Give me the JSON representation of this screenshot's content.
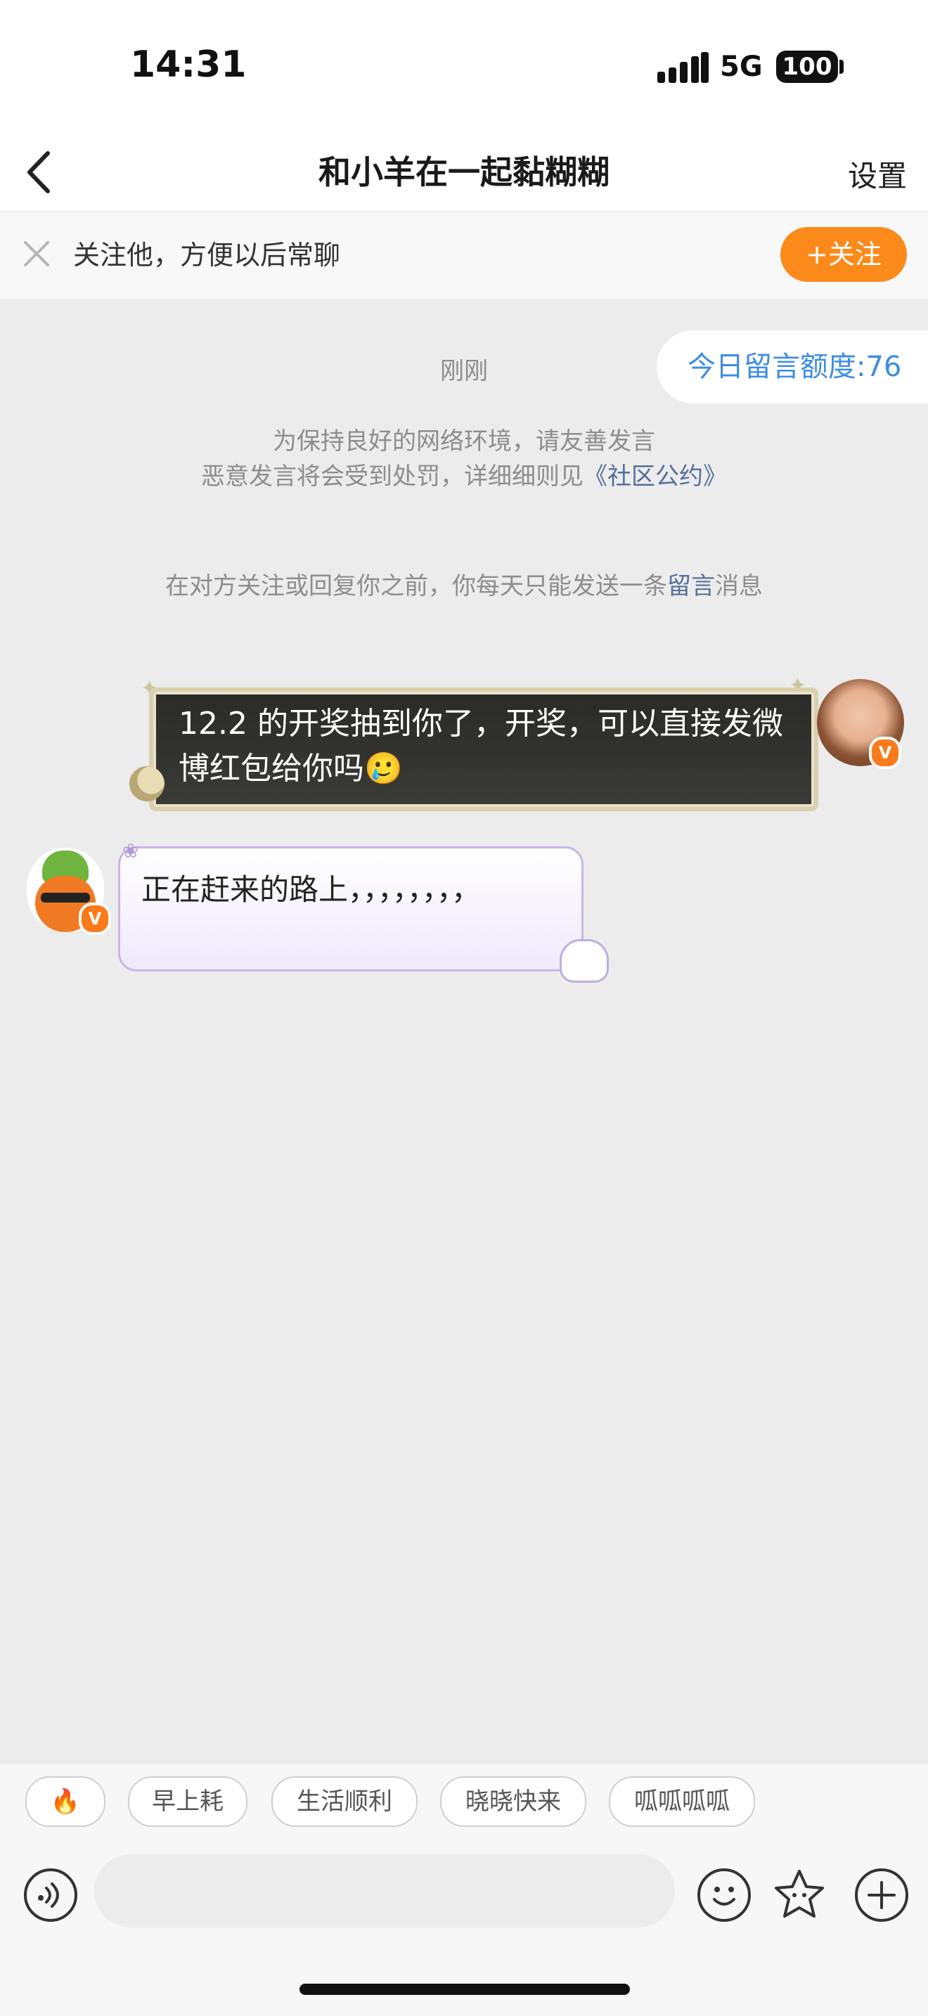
{
  "status_bar": {
    "time": "14:31",
    "network": "5G",
    "battery": "100"
  },
  "header": {
    "title": "和小羊在一起黏糊糊",
    "settings_label": "设置"
  },
  "follow_banner": {
    "text": "关注他，方便以后常聊",
    "follow_button": "+关注"
  },
  "quota": {
    "label": "今日留言额度:76"
  },
  "chat": {
    "timestamp": "刚刚",
    "rules_line1": "为保持良好的网络环境，请友善发言",
    "rules_line2_prefix": "恶意发言将会受到处罚，详细细则见",
    "rules_link": "《社区公约》",
    "limit_prefix": "在对方关注或回复你之前，你每天只能发送一条",
    "limit_link": "留言",
    "limit_suffix": "消息",
    "messages": [
      {
        "side": "right",
        "text": "12.2 的开奖抽到你了，开奖，可以直接发微博红包给你吗🥲",
        "badge": "V"
      },
      {
        "side": "left",
        "text": "正在赶来的路上，，，，，，，，",
        "badge": "V"
      }
    ]
  },
  "quick_replies": [
    "🔥",
    "早上耗",
    "生活顺利",
    "晓晓快来",
    "呱呱呱呱"
  ],
  "input": {
    "placeholder": ""
  },
  "colors": {
    "accent_orange": "#fb8a1a",
    "link_blue": "#3d8de3",
    "background": "#ececec"
  }
}
